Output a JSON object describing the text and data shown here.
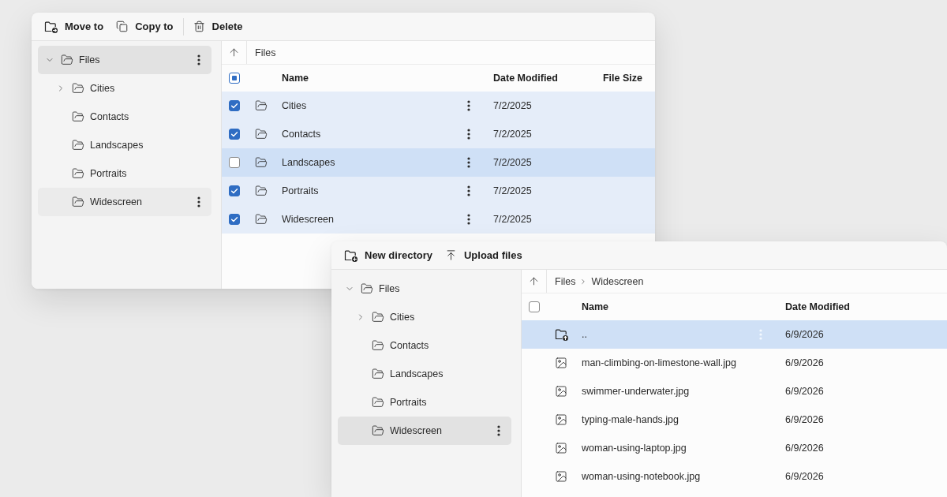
{
  "windows": [
    {
      "toolbar": [
        {
          "kind": "move",
          "label": "Move to"
        },
        {
          "kind": "copy",
          "label": "Copy to"
        },
        {
          "kind": "separator"
        },
        {
          "kind": "delete",
          "label": "Delete"
        }
      ],
      "tree": [
        {
          "label": "Files",
          "expanded": true,
          "selected": true,
          "hovered": false,
          "children": [
            {
              "label": "Cities",
              "expanded": false,
              "selected": false,
              "hovered": false
            },
            {
              "label": "Contacts",
              "selected": false,
              "hovered": false
            },
            {
              "label": "Landscapes",
              "selected": false,
              "hovered": false
            },
            {
              "label": "Portraits",
              "selected": false,
              "hovered": false
            },
            {
              "label": "Widescreen",
              "selected": false,
              "hovered": true
            }
          ]
        }
      ],
      "breadcrumb": [
        "Files"
      ],
      "header_checkbox": {
        "checked": false,
        "indeterminate": true
      },
      "columns": [
        {
          "kind": "name",
          "label": "Name"
        },
        {
          "kind": "date",
          "label": "Date Modified"
        },
        {
          "kind": "size",
          "label": "File Size"
        }
      ],
      "rows": [
        {
          "kind": "folder",
          "name": "Cities",
          "date": "7/2/2025",
          "checked": true,
          "highlighted": false,
          "menu": true
        },
        {
          "kind": "folder",
          "name": "Contacts",
          "date": "7/2/2025",
          "checked": true,
          "highlighted": false,
          "menu": true
        },
        {
          "kind": "folder",
          "name": "Landscapes",
          "date": "7/2/2025",
          "checked": false,
          "highlighted": true,
          "menu": true
        },
        {
          "kind": "folder",
          "name": "Portraits",
          "date": "7/2/2025",
          "checked": true,
          "highlighted": false,
          "menu": true
        },
        {
          "kind": "folder",
          "name": "Widescreen",
          "date": "7/2/2025",
          "checked": true,
          "highlighted": false,
          "menu": true
        }
      ]
    },
    {
      "toolbar": [
        {
          "kind": "new-directory",
          "label": "New directory"
        },
        {
          "kind": "upload",
          "label": "Upload files"
        }
      ],
      "tree": [
        {
          "label": "Files",
          "expanded": true,
          "selected": false,
          "hovered": false,
          "children": [
            {
              "label": "Cities",
              "expanded": false,
              "selected": false,
              "hovered": false
            },
            {
              "label": "Contacts",
              "selected": false,
              "hovered": false
            },
            {
              "label": "Landscapes",
              "selected": false,
              "hovered": false
            },
            {
              "label": "Portraits",
              "selected": false,
              "hovered": false
            },
            {
              "label": "Widescreen",
              "selected": true,
              "hovered": false
            }
          ]
        }
      ],
      "breadcrumb": [
        "Files",
        "Widescreen"
      ],
      "header_checkbox": {
        "checked": false,
        "indeterminate": false
      },
      "columns": [
        {
          "kind": "name",
          "label": "Name"
        },
        {
          "kind": "date",
          "label": "Date Modified"
        }
      ],
      "rows": [
        {
          "kind": "parent",
          "name": "..",
          "date": "6/9/2026",
          "highlighted": true,
          "menu": true
        },
        {
          "kind": "image",
          "name": "man-climbing-on-limestone-wall.jpg",
          "date": "6/9/2026",
          "highlighted": false,
          "menu": false
        },
        {
          "kind": "image",
          "name": "swimmer-underwater.jpg",
          "date": "6/9/2026",
          "highlighted": false,
          "menu": false
        },
        {
          "kind": "image",
          "name": "typing-male-hands.jpg",
          "date": "6/9/2026",
          "highlighted": false,
          "menu": false
        },
        {
          "kind": "image",
          "name": "woman-using-laptop.jpg",
          "date": "6/9/2026",
          "highlighted": false,
          "menu": false
        },
        {
          "kind": "image",
          "name": "woman-using-notebook.jpg",
          "date": "6/9/2026",
          "highlighted": false,
          "menu": false
        }
      ]
    }
  ]
}
